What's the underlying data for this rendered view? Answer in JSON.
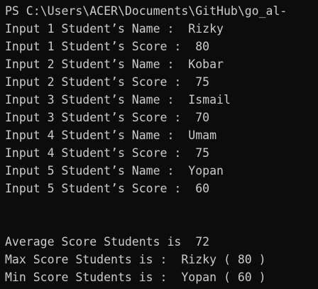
{
  "terminal": {
    "colors": {
      "background": "#0c0c0c",
      "foreground": "#cccccc"
    },
    "prompt": "PS C:\\Users\\ACER\\Documents\\GitHub\\go_al-",
    "inputs": [
      "Input 1 Student’s Name :  Rizky",
      "Input 1 Student’s Score :  80",
      "Input 2 Student’s Name :  Kobar",
      "Input 2 Student’s Score :  75",
      "Input 3 Student’s Name :  Ismail",
      "Input 3 Student’s Score :  70",
      "Input 4 Student’s Name :  Umam",
      "Input 4 Student’s Score :  75",
      "Input 5 Student’s Name :  Yopan",
      "Input 5 Student’s Score :  60"
    ],
    "results": [
      "Average Score Students is  72",
      "Max Score Students is :  Rizky ( 80 )",
      "Min Score Students is :  Yopan ( 60 )"
    ]
  }
}
